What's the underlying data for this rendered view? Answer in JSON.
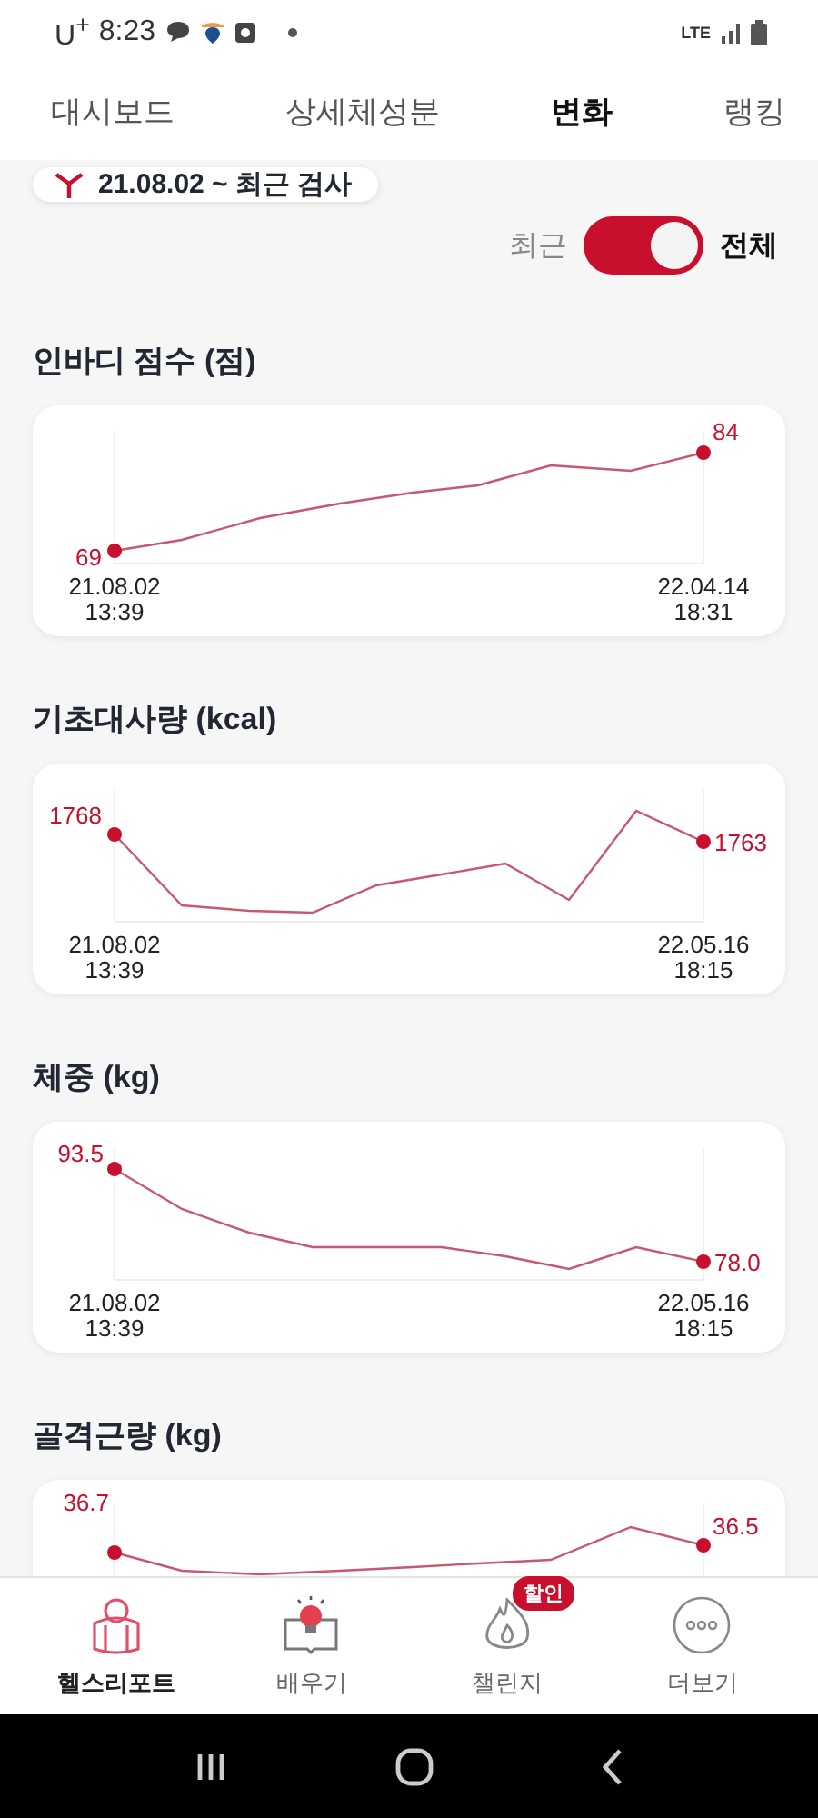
{
  "status_bar": {
    "carrier": "U$^{+}$",
    "time": "8:23",
    "network": "LTE"
  },
  "tabs": [
    {
      "label": "대시보드",
      "selected": false
    },
    {
      "label": "상세체성분",
      "selected": false
    },
    {
      "label": "변화",
      "selected": true
    },
    {
      "label": "랭킹",
      "selected": false
    }
  ],
  "filter": {
    "label": "21.08.02 ~ 최근 검사"
  },
  "range_toggle": {
    "left_label": "최근",
    "right_label": "전체",
    "on": true
  },
  "charts": [
    {
      "title": "인바디 점수 (점)",
      "start_value": "69",
      "end_value": "84",
      "start_date": "21.08.02",
      "start_time": "13:39",
      "end_date": "22.04.14",
      "end_time": "18:31"
    },
    {
      "title": "기초대사량 (kcal)",
      "start_value": "1768",
      "end_value": "1763",
      "start_date": "21.08.02",
      "start_time": "13:39",
      "end_date": "22.05.16",
      "end_time": "18:15"
    },
    {
      "title": "체중 (kg)",
      "start_value": "93.5",
      "end_value": "78.0",
      "start_date": "21.08.02",
      "start_time": "13:39",
      "end_date": "22.05.16",
      "end_time": "18:15"
    },
    {
      "title": "골격근량 (kg)",
      "start_value": "36.7",
      "end_value": "36.5"
    }
  ],
  "bottom_nav": [
    {
      "label": "헬스리포트",
      "selected": true
    },
    {
      "label": "배우기",
      "selected": false
    },
    {
      "label": "챌린지",
      "selected": false,
      "badge": "할인"
    },
    {
      "label": "더보기",
      "selected": false
    }
  ]
}
